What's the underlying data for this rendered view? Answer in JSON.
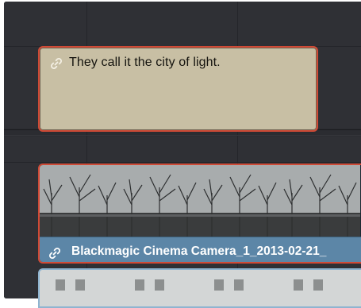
{
  "subtitle_track": {
    "clip": {
      "text": "They call it the city of light.",
      "icon": "link-icon",
      "color": "#c8bfa4",
      "border_color": "#d04a36"
    }
  },
  "video_track": {
    "clip": {
      "name": "Blackmagic Cinema Camera_1_2013-02-21_",
      "icon": "link-icon",
      "label_color": "#5c86a7",
      "selected_border_color": "#d04a36"
    },
    "next_clip": {
      "border_color": "#8fb4d0"
    }
  }
}
